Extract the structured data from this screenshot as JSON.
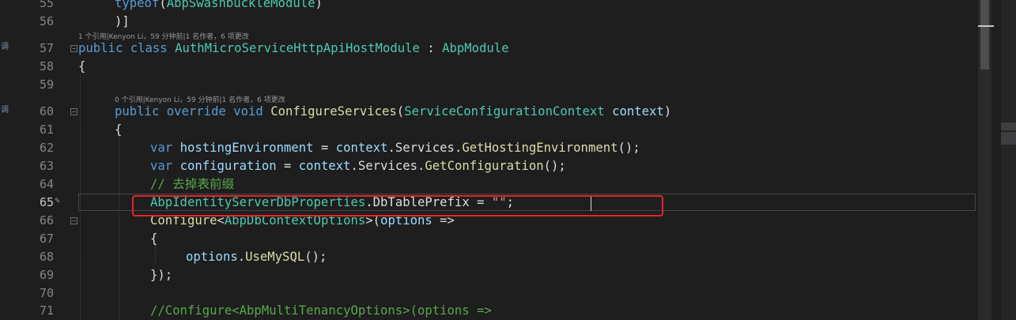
{
  "code_lens": {
    "class_refs": "1 个引用|Kenyon Li，59 分钟前|1 名作者，6 项更改",
    "method_refs": "0 个引用|Kenyon Li，59 分钟前|1 名作者，6 项更改"
  },
  "margin_marks": [
    "调",
    "调"
  ],
  "lines": {
    "l55": {
      "num": "55",
      "typeof": "typeof",
      "p1": "(",
      "module": "AbpSwashbuckleModule",
      "p2": ")"
    },
    "l56": {
      "num": "56",
      "text": ")]"
    },
    "l57": {
      "num": "57",
      "kw1": "public",
      "kw2": "class",
      "name": "AuthMicroServiceHttpApiHostModule",
      "colon": " : ",
      "base": "AbpModule"
    },
    "l58": {
      "num": "58",
      "text": "{"
    },
    "l59": {
      "num": "59"
    },
    "l60": {
      "num": "60",
      "kw1": "public",
      "kw2": "override",
      "kw3": "void",
      "fn": "ConfigureServices",
      "p1": "(",
      "type": "ServiceConfigurationContext",
      "param": "context",
      "p2": ")"
    },
    "l61": {
      "num": "61",
      "text": "{"
    },
    "l62": {
      "num": "62",
      "kw": "var",
      "name": "hostingEnvironment",
      "eq": " = ",
      "obj": "context",
      "dot1": ".",
      "prop": "Services",
      "dot2": ".",
      "fn": "GetHostingEnvironment",
      "end": "();"
    },
    "l63": {
      "num": "63",
      "kw": "var",
      "name": "configuration",
      "eq": " = ",
      "obj": "context",
      "dot1": ".",
      "prop": "Services",
      "dot2": ".",
      "fn": "GetConfiguration",
      "end": "();"
    },
    "l64": {
      "num": "64",
      "comment": "// 去掉表前缀"
    },
    "l65": {
      "num": "65",
      "cls": "AbpIdentityServerDbProperties",
      "dot": ".",
      "prop": "DbTablePrefix",
      "eq": " = ",
      "str": "\"\"",
      "end": ";"
    },
    "l66": {
      "num": "66",
      "fn": "Configure",
      "lt": "<",
      "type": "AbpDbContextOptions",
      "gt": ">",
      "p1": "(",
      "param": "options",
      "arrow": " =>"
    },
    "l67": {
      "num": "67",
      "text": "{"
    },
    "l68": {
      "num": "68",
      "obj": "options",
      "dot": ".",
      "fn": "UseMySQL",
      "end": "();"
    },
    "l69": {
      "num": "69",
      "text": "});"
    },
    "l70": {
      "num": "70"
    },
    "l71": {
      "num": "71",
      "comment": "//Configure<AbpMultiTenancyOptions>(options =>"
    }
  },
  "colors": {
    "background": "#1e1e1e",
    "keyword": "#569cd6",
    "type": "#4ec9b0",
    "method": "#dcdcaa",
    "variable": "#9cdcfe",
    "string": "#d69d85",
    "comment": "#57a64a",
    "highlight": "#e0252b"
  }
}
